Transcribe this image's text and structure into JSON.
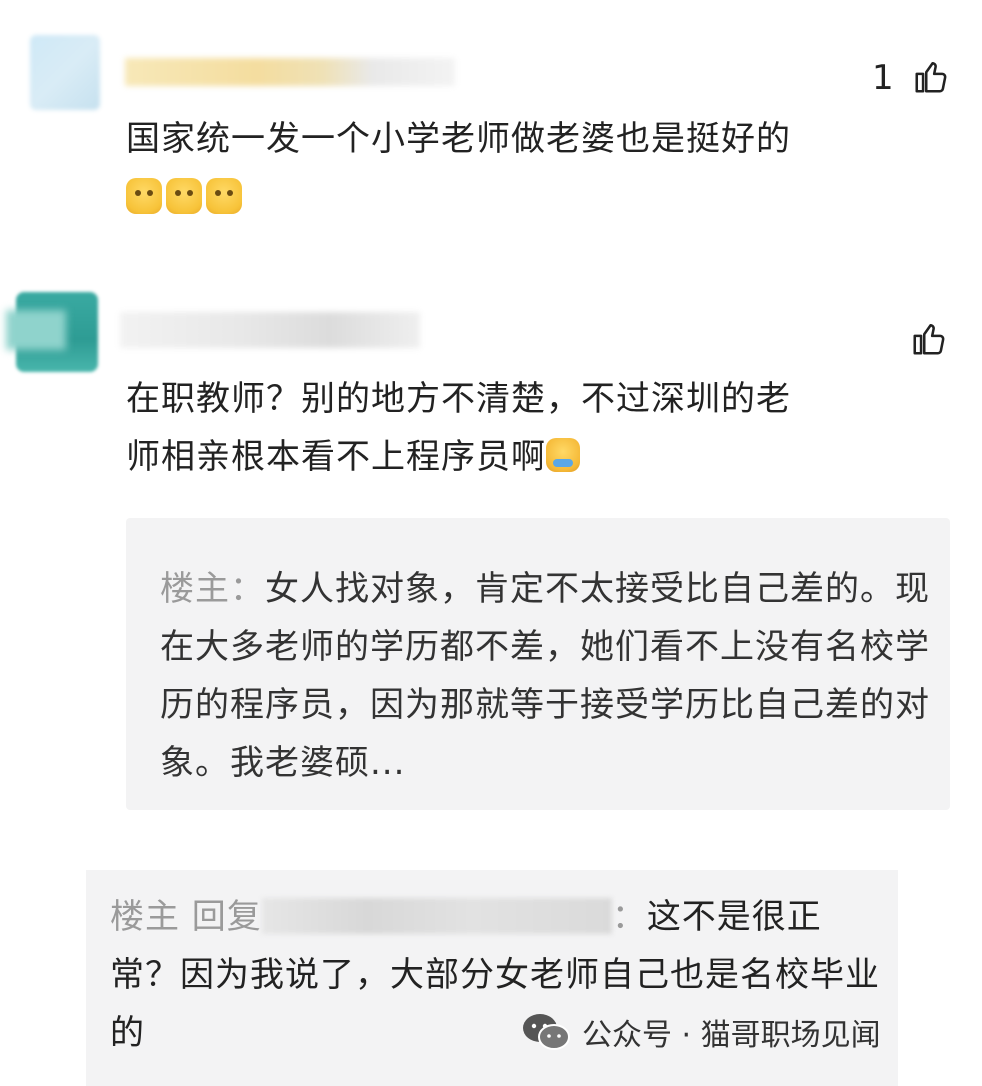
{
  "comment1": {
    "likes": "1",
    "text": "国家统一发一个小学老师做老婆也是挺好的"
  },
  "comment2": {
    "line1": "在职教师？别的地方不清楚，不过深圳的老",
    "line2": "师相亲根本看不上程序员啊",
    "quote": {
      "author": "楼主：",
      "text": "女人找对象，肯定不太接受比自己差的。现在大多老师的学历都不差，她们看不上没有名校学历的程序员，因为那就等于接受学历比自己差的对象。我老婆硕..."
    }
  },
  "reply": {
    "prefix": "楼主 回复",
    "colon": "：",
    "text": "这不是很正常？因为我说了，大部分女老师自己也是名校毕业的"
  },
  "watermark": {
    "text": "公众号 · 猫哥职场见闻"
  }
}
